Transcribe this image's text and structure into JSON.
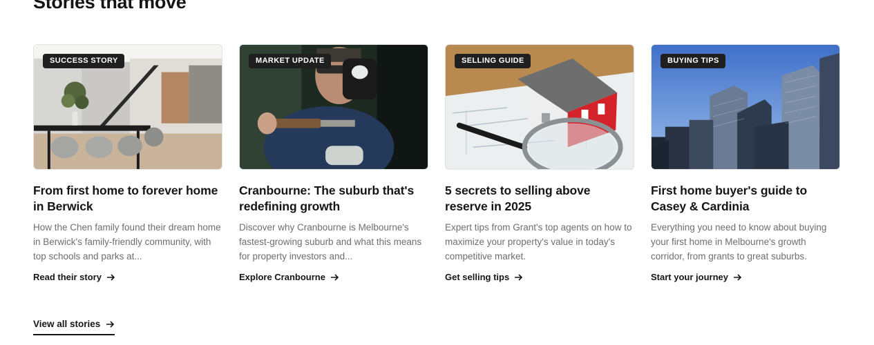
{
  "section": {
    "title": "Stories that move"
  },
  "cards": [
    {
      "badge": "SUCCESS STORY",
      "image": "modern-dining-room-photo",
      "title": "From first home to forever home in Berwick",
      "description": "How the Chen family found their dream home in Berwick's family-friendly community, with top schools and parks at...",
      "link": "Read their story",
      "icon": "arrow-right-icon"
    },
    {
      "badge": "MARKET UPDATE",
      "image": "tradesman-with-tools-photo",
      "title": "Cranbourne: The suburb that's redefining growth",
      "description": "Discover why Cranbourne is Melbourne's fastest-growing suburb and what this means for property investors and...",
      "link": "Explore Cranbourne",
      "icon": "arrow-right-icon"
    },
    {
      "badge": "SELLING GUIDE",
      "image": "house-model-on-blueprint-photo",
      "title": "5 secrets to selling above reserve in 2025",
      "description": "Expert tips from Grant's top agents on how to maximize your property's value in today's competitive market.",
      "link": "Get selling tips",
      "icon": "arrow-right-icon"
    },
    {
      "badge": "BUYING TIPS",
      "image": "city-skyscrapers-photo",
      "title": "First home buyer's guide to Casey & Cardinia",
      "description": "Everything you need to know about buying your first home in Melbourne's growth corridor, from grants to great suburbs.",
      "link": "Start your journey",
      "icon": "arrow-right-icon"
    }
  ],
  "footer": {
    "view_all": "View all stories"
  },
  "colors": {
    "text": "#151515",
    "muted": "#6e6e6e",
    "badge_bg": "#1f1f1f"
  }
}
